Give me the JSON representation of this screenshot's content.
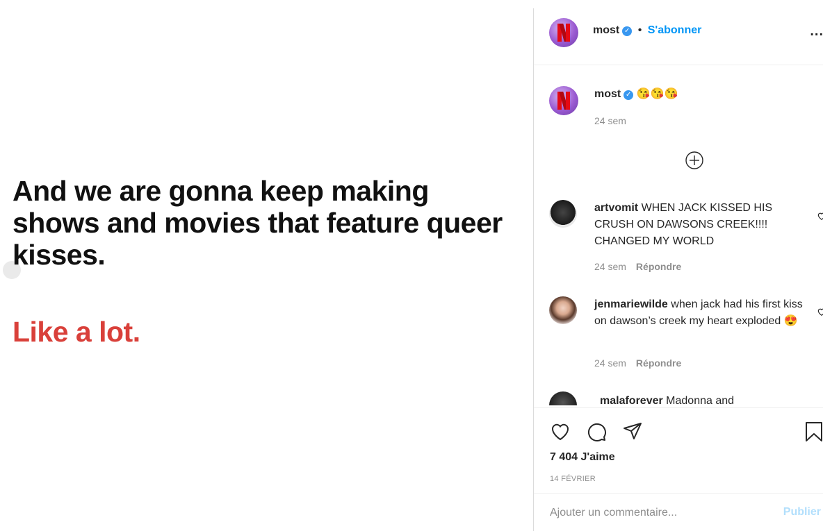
{
  "image": {
    "headline": "And we are gonna keep making shows and movies that feature queer kisses.",
    "tagline": "Like a lot.",
    "colors": {
      "headline": "#111111",
      "tagline": "#d9403a"
    }
  },
  "header": {
    "username": "most",
    "separator": "•",
    "follow_label": "S'abonner",
    "more_label": "..."
  },
  "caption": {
    "username": "most",
    "text": "😘😘😘",
    "time": "24 sem"
  },
  "comments": [
    {
      "username": "artvomit",
      "text": "WHEN JACK KISSED HIS CRUSH ON DAWSONS CREEK!!!! CHANGED MY WORLD",
      "time": "24 sem",
      "reply_label": "Répondre"
    },
    {
      "username": "jenmariewilde",
      "text": "when jack had his first kiss on dawson’s creek my heart exploded 😍",
      "time": "24 sem",
      "reply_label": "Répondre"
    },
    {
      "username": "malaforever",
      "text": "Madonna and"
    }
  ],
  "footer": {
    "likes": "7 404 J'aime",
    "date": "14 FÉVRIER",
    "comment_placeholder": "Ajouter un commentaire...",
    "publish_label": "Publier"
  },
  "icons": {
    "like": "heart-icon",
    "comment": "comment-bubble-icon",
    "share": "paper-plane-icon",
    "save": "bookmark-icon",
    "load_more": "plus-circle-icon"
  },
  "colors": {
    "accent": "#0095f6",
    "verified": "#3897f0",
    "muted": "#8e8e8e"
  }
}
